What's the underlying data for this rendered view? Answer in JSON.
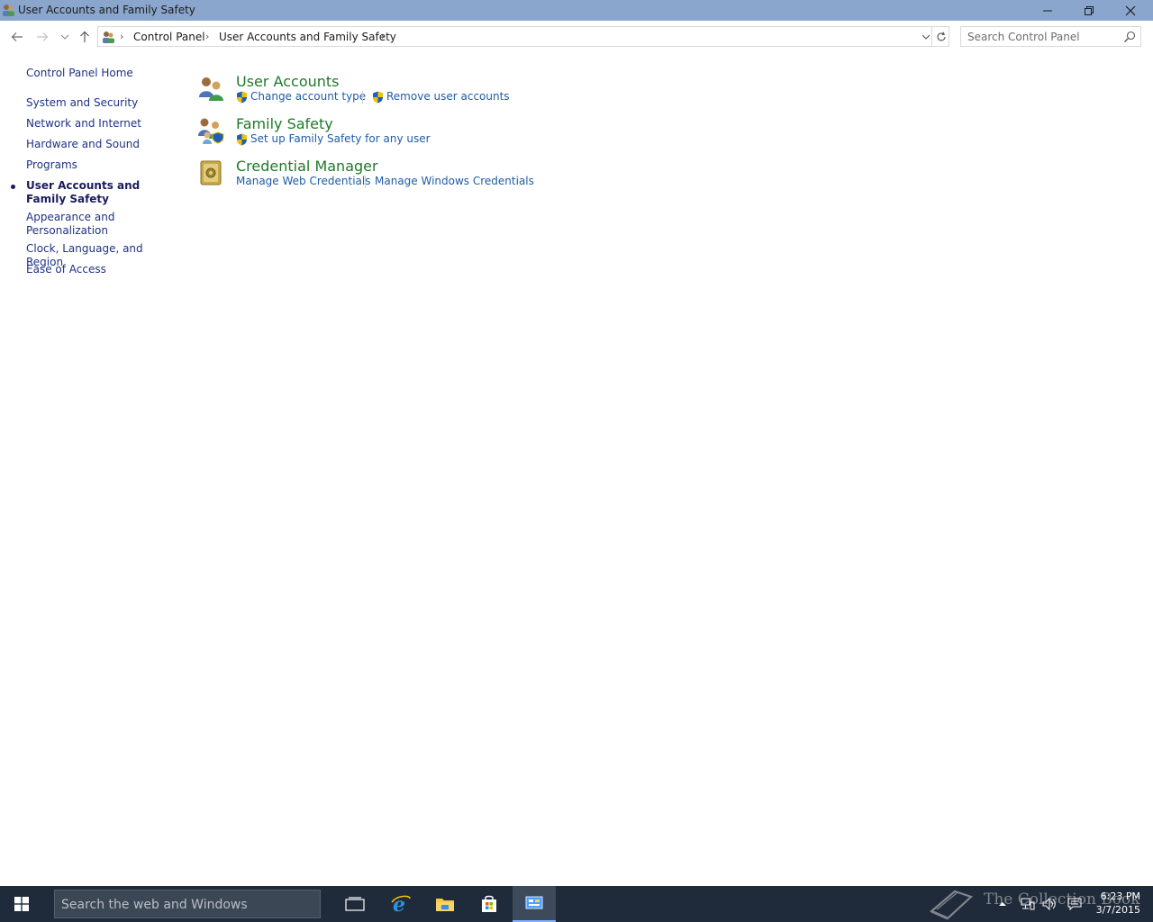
{
  "window": {
    "title": "User Accounts and Family Safety"
  },
  "nav": {
    "back_icon": "back-arrow-icon",
    "forward_icon": "forward-arrow-icon",
    "recent_icon": "chevron-down-icon",
    "up_icon": "up-arrow-icon"
  },
  "address": {
    "crumbs": [
      "Control Panel",
      "User Accounts and Family Safety"
    ]
  },
  "search": {
    "placeholder": "Search Control Panel"
  },
  "sidebar": {
    "home": "Control Panel Home",
    "items": [
      {
        "label": "System and Security"
      },
      {
        "label": "Network and Internet"
      },
      {
        "label": "Hardware and Sound"
      },
      {
        "label": "Programs"
      },
      {
        "label": "User Accounts and Family Safety",
        "current": true
      },
      {
        "label": "Appearance and Personalization"
      },
      {
        "label": "Clock, Language, and Region"
      },
      {
        "label": "Ease of Access"
      }
    ]
  },
  "categories": [
    {
      "title": "User Accounts",
      "icon": "user-accounts-icon",
      "tasks": [
        {
          "label": "Change account type",
          "shield": true
        },
        {
          "label": "Remove user accounts",
          "shield": true
        }
      ]
    },
    {
      "title": "Family Safety",
      "icon": "family-safety-icon",
      "tasks": [
        {
          "label": "Set up Family Safety for any user",
          "shield": true
        }
      ]
    },
    {
      "title": "Credential Manager",
      "icon": "credential-manager-icon",
      "tasks": [
        {
          "label": "Manage Web Credentials",
          "shield": false
        },
        {
          "label": "Manage Windows Credentials",
          "shield": false
        }
      ]
    }
  ],
  "taskbar": {
    "search_placeholder": "Search the web and Windows",
    "apps": [
      "task-view-icon",
      "internet-explorer-icon",
      "file-explorer-icon",
      "store-icon",
      "control-panel-icon"
    ],
    "clock_time": "6:23 PM",
    "clock_date": "3/7/2015",
    "watermark": "The Collection Book"
  },
  "colors": {
    "titlebar": "#8aa6cd",
    "link": "#1e5ca8",
    "category_title": "#1e7a28",
    "nav_link": "#1e3287",
    "taskbar": "#1f2a3a"
  }
}
